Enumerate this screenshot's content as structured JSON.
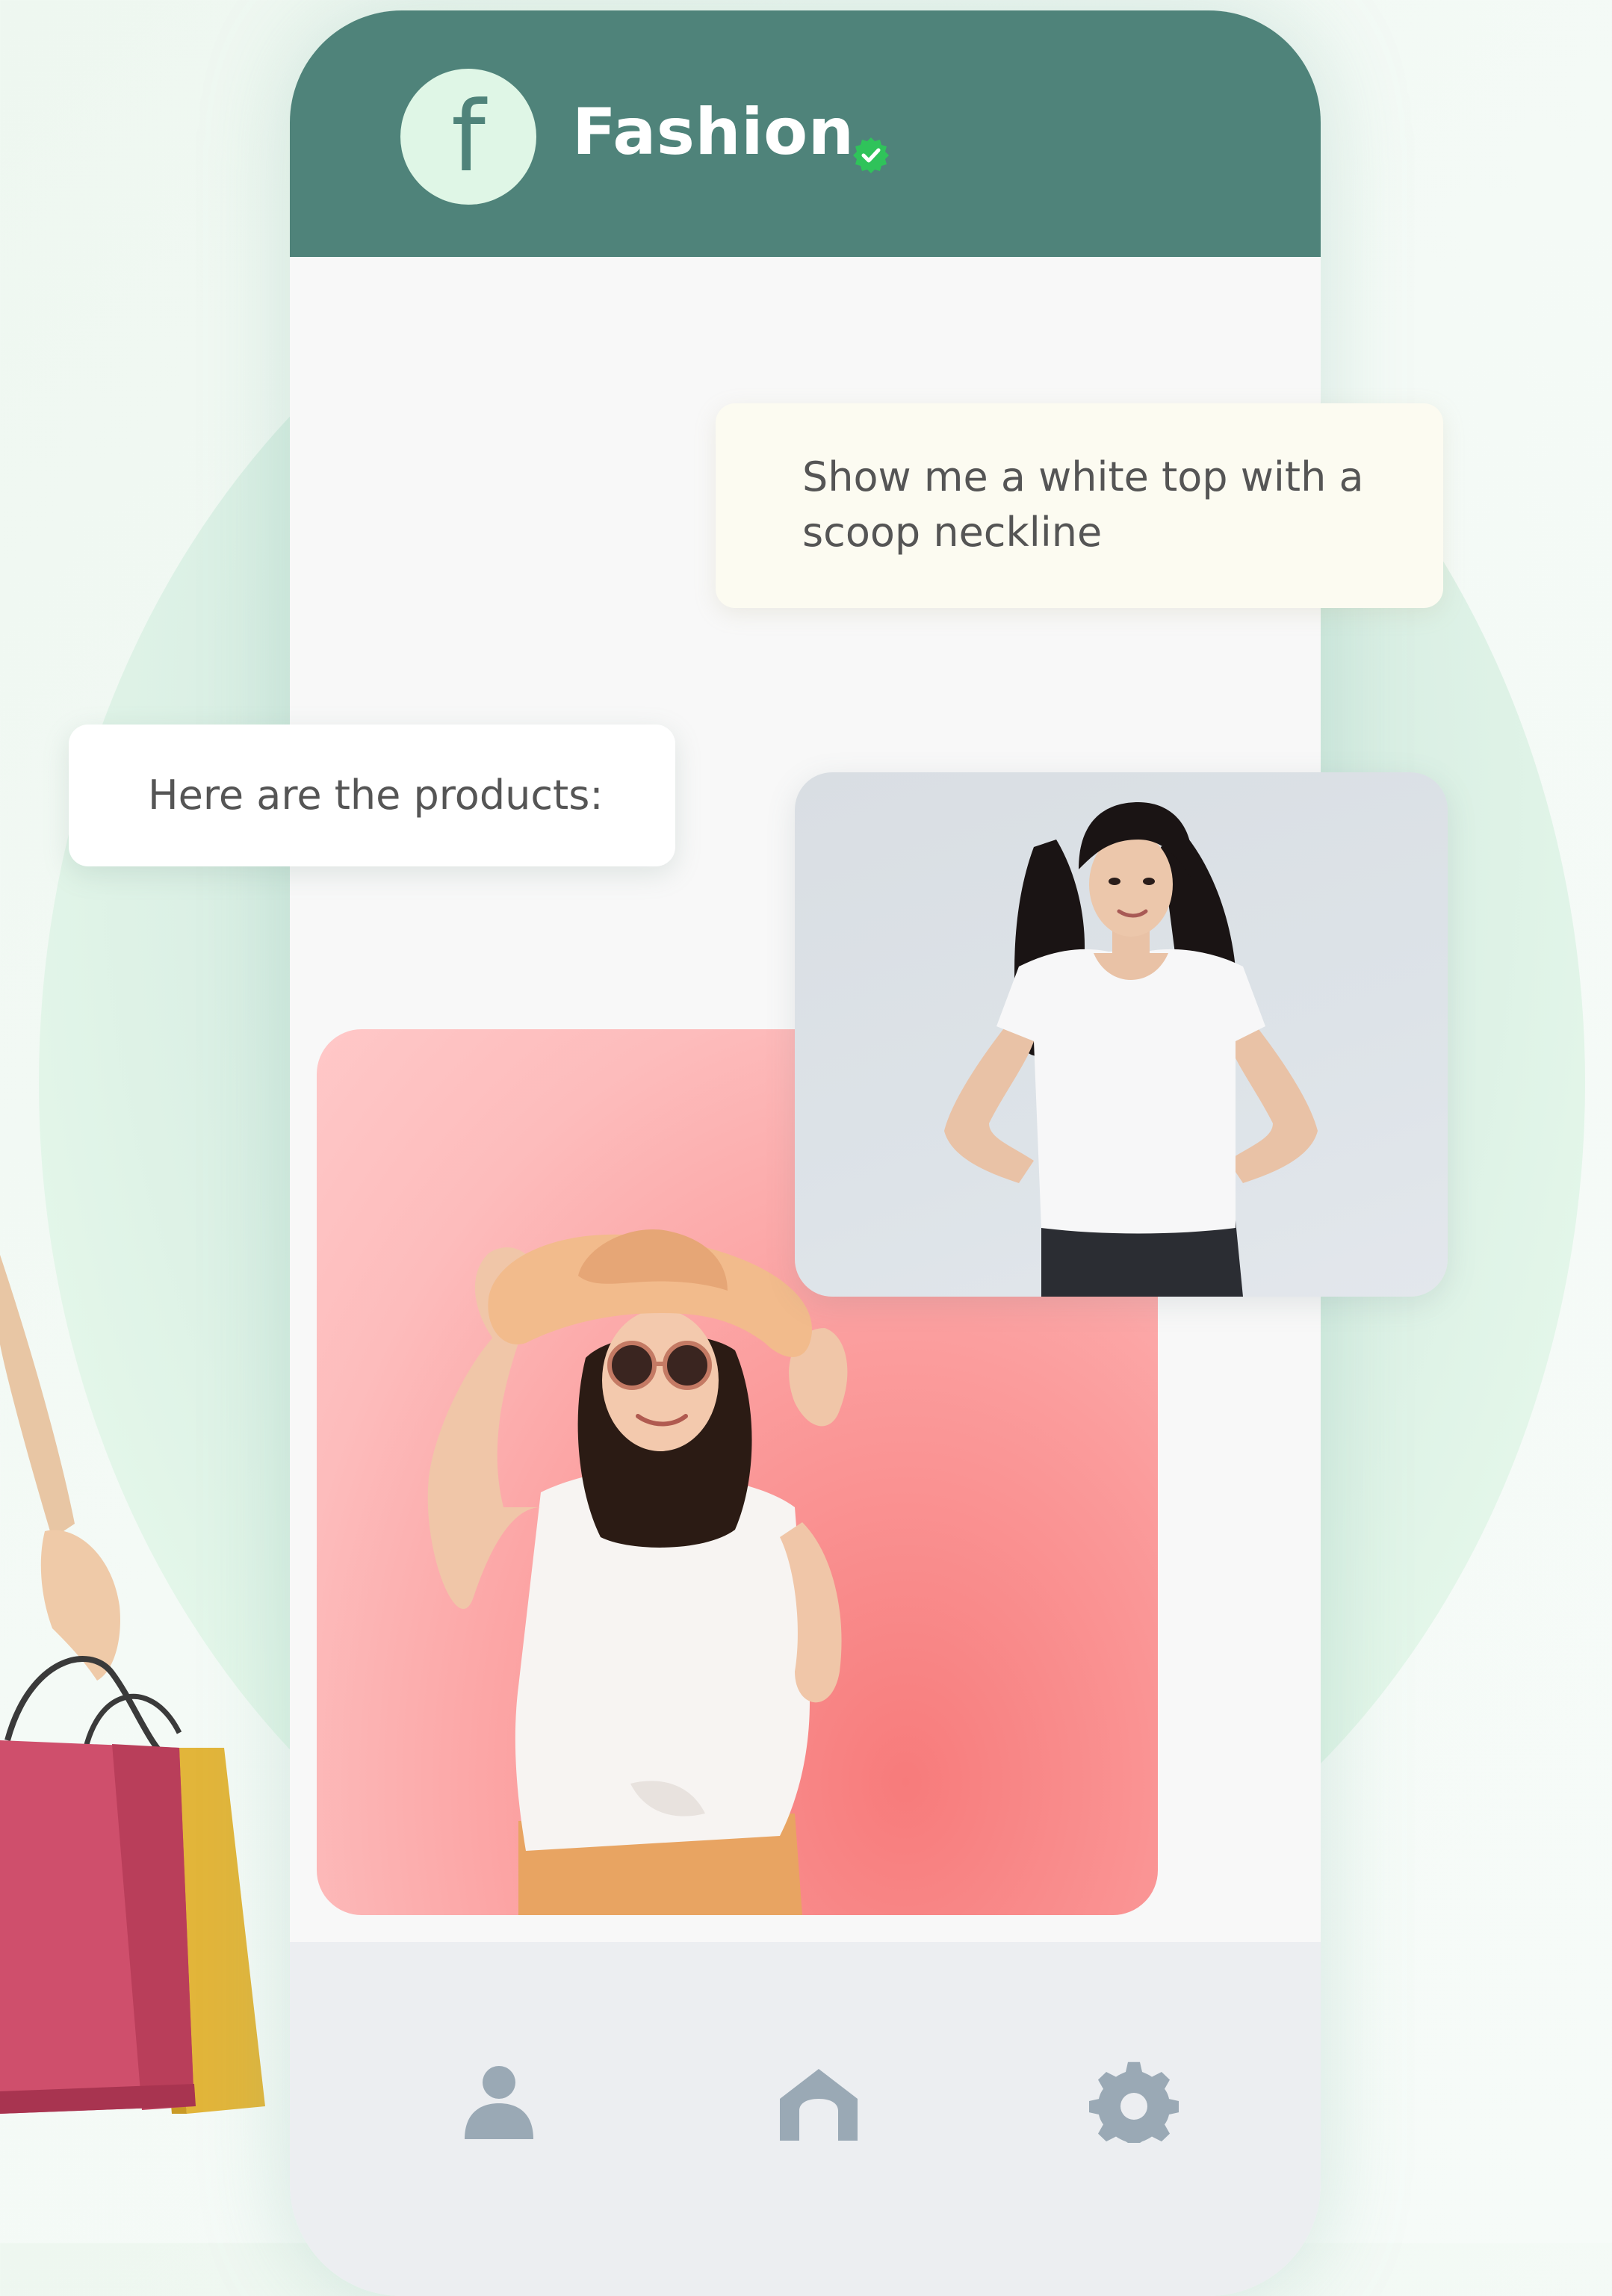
{
  "header": {
    "logo_letter": "f",
    "brand_name": "Fashion"
  },
  "chat": {
    "user_message": "Show me a white top with a scoop neckline",
    "bot_message": "Here are the products:"
  },
  "nav": {
    "items": [
      {
        "icon": "profile-icon"
      },
      {
        "icon": "home-icon"
      },
      {
        "icon": "gear-icon"
      }
    ]
  },
  "colors": {
    "header": "#4f837a",
    "logo_bg": "#dff6e6",
    "verified": "#2fc35a",
    "nav_icon": "#9aa9b5"
  }
}
